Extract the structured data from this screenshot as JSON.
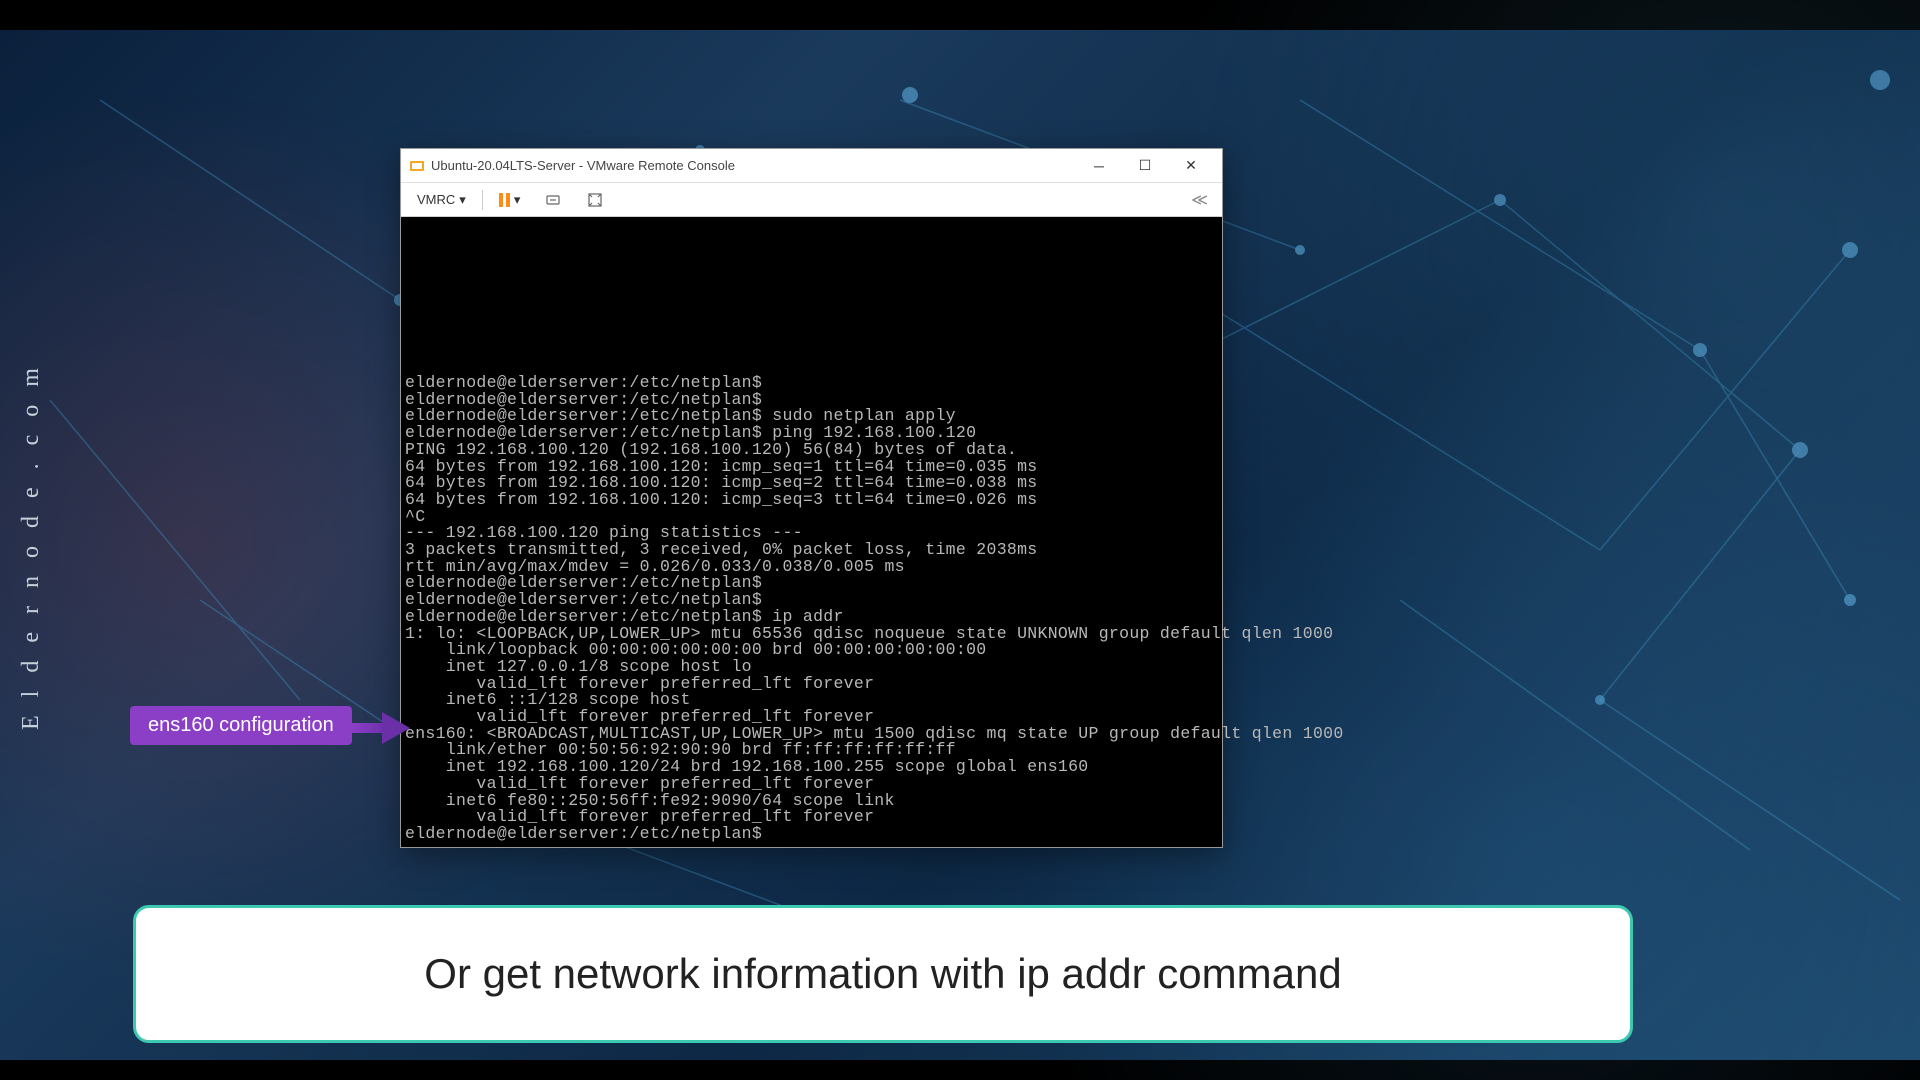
{
  "watermark": "Eldernode.com",
  "window": {
    "title": "Ubuntu-20.04LTS-Server - VMware Remote Console",
    "toolbar": {
      "vmrc_label": "VMRC",
      "dropdown_caret": "▾",
      "collapse": "≪"
    }
  },
  "terminal": {
    "lines": [
      "eldernode@elderserver:/etc/netplan$",
      "eldernode@elderserver:/etc/netplan$",
      "eldernode@elderserver:/etc/netplan$ sudo netplan apply",
      "eldernode@elderserver:/etc/netplan$ ping 192.168.100.120",
      "PING 192.168.100.120 (192.168.100.120) 56(84) bytes of data.",
      "64 bytes from 192.168.100.120: icmp_seq=1 ttl=64 time=0.035 ms",
      "64 bytes from 192.168.100.120: icmp_seq=2 ttl=64 time=0.038 ms",
      "64 bytes from 192.168.100.120: icmp_seq=3 ttl=64 time=0.026 ms",
      "^C",
      "--- 192.168.100.120 ping statistics ---",
      "3 packets transmitted, 3 received, 0% packet loss, time 2038ms",
      "rtt min/avg/max/mdev = 0.026/0.033/0.038/0.005 ms",
      "eldernode@elderserver:/etc/netplan$",
      "eldernode@elderserver:/etc/netplan$",
      "eldernode@elderserver:/etc/netplan$ ip addr",
      "1: lo: <LOOPBACK,UP,LOWER_UP> mtu 65536 qdisc noqueue state UNKNOWN group default qlen 1000",
      "    link/loopback 00:00:00:00:00:00 brd 00:00:00:00:00:00",
      "    inet 127.0.0.1/8 scope host lo",
      "       valid_lft forever preferred_lft forever",
      "    inet6 ::1/128 scope host",
      "       valid_lft forever preferred_lft forever",
      "ens160: <BROADCAST,MULTICAST,UP,LOWER_UP> mtu 1500 qdisc mq state UP group default qlen 1000",
      "    link/ether 00:50:56:92:90:90 brd ff:ff:ff:ff:ff:ff",
      "    inet 192.168.100.120/24 brd 192.168.100.255 scope global ens160",
      "       valid_lft forever preferred_lft forever",
      "    inet6 fe80::250:56ff:fe92:9090/64 scope link",
      "       valid_lft forever preferred_lft forever",
      "eldernode@elderserver:/etc/netplan$"
    ]
  },
  "annotation": {
    "label": "ens160 configuration"
  },
  "caption": "Or get network information with ip addr command"
}
